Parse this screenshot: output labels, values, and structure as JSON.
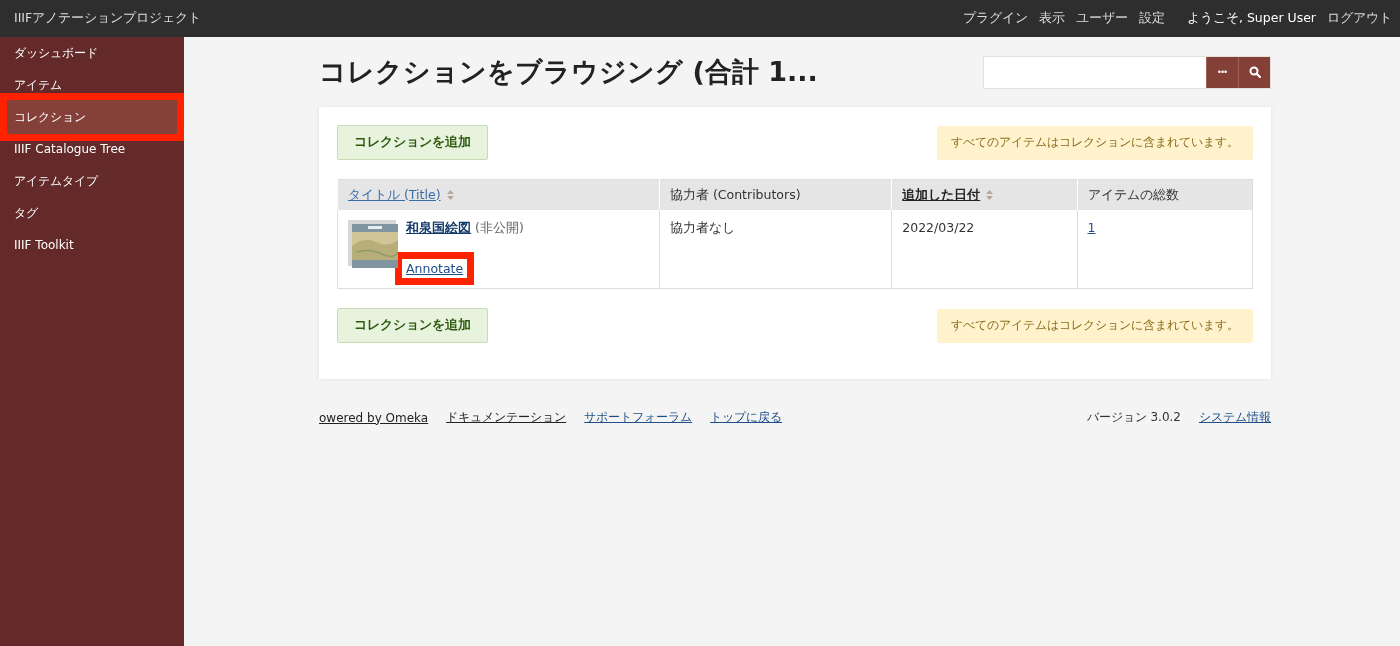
{
  "site_title": "IIIFアノテーションプロジェクト",
  "top_nav": [
    "プラグイン",
    "表示",
    "ユーザー",
    "設定"
  ],
  "welcome": "ようこそ, Super User",
  "logout": "ログアウト",
  "sidebar": {
    "items": [
      {
        "label": "ダッシュボード",
        "selected": false,
        "highlighted": false
      },
      {
        "label": "アイテム",
        "selected": false,
        "highlighted": false
      },
      {
        "label": "コレクション",
        "selected": true,
        "highlighted": true
      },
      {
        "label": "IIIF Catalogue Tree",
        "selected": false,
        "highlighted": false
      },
      {
        "label": "アイテムタイプ",
        "selected": false,
        "highlighted": false
      },
      {
        "label": "タグ",
        "selected": false,
        "highlighted": false
      },
      {
        "label": "IIIF Toolkit",
        "selected": false,
        "highlighted": false
      }
    ]
  },
  "page_title": "コレクションをブラウジング (合計 1...",
  "search": {
    "more_button": "•••"
  },
  "top_bar": {
    "add_button": "コレクションを追加",
    "notice": "すべてのアイテムはコレクションに含まれています。"
  },
  "table": {
    "columns": [
      {
        "label": "タイトル (Title)",
        "kind": "sort",
        "sorted": false
      },
      {
        "label": "協力者 (Contributors)",
        "kind": "plain"
      },
      {
        "label": "追加した日付",
        "kind": "sort",
        "sorted": true
      },
      {
        "label": "アイテムの総数",
        "kind": "plain"
      }
    ],
    "rows": [
      {
        "title": "和泉国絵図",
        "status": "(非公開)",
        "annotate": "Annotate",
        "annotate_highlighted": true,
        "contributors": "協力者なし",
        "date": "2022/03/22",
        "count": "1"
      }
    ]
  },
  "bottom_bar": {
    "add_button": "コレクションを追加",
    "notice": "すべてのアイテムはコレクションに含まれています。"
  },
  "footer": {
    "links": [
      "owered by Omeka",
      "ドキュメンテーション",
      "サポートフォーラム",
      "トップに戻る"
    ],
    "version": "バージョン 3.0.2",
    "system_info": "システム情報"
  }
}
